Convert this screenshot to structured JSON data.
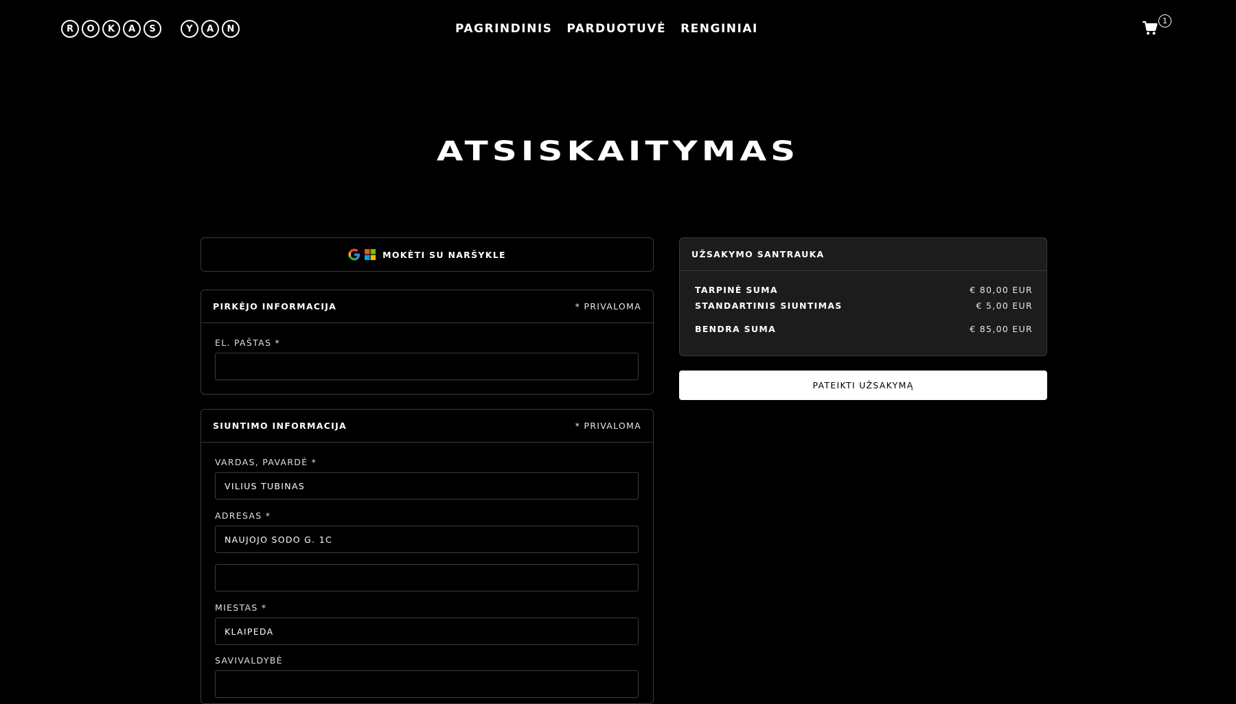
{
  "logo": {
    "first": [
      "R",
      "O",
      "K",
      "A",
      "S"
    ],
    "second": [
      "Y",
      "A",
      "N"
    ]
  },
  "nav": [
    "PAGRINDINIS",
    "PARDUOTUVĖ",
    "RENGINIAI"
  ],
  "cart": {
    "icon": "cart-icon",
    "count": "1"
  },
  "page_title": "ATSISKAITYMAS",
  "browser_pay": {
    "label": "MOKĖTI SU NARŠYKLE",
    "icons": [
      "google-icon",
      "microsoft-icon"
    ]
  },
  "buyer": {
    "title": "PIRKĖJO INFORMACIJA",
    "required_note": "* PRIVALOMA",
    "email_label": "EL. PAŠTAS *",
    "email_value": ""
  },
  "shipping": {
    "title": "SIUNTIMO INFORMACIJA",
    "required_note": "* PRIVALOMA",
    "name_label": "VARDAS, PAVARDĖ *",
    "name_value": "VILIUS TUBINAS",
    "address_label": "ADRESAS *",
    "address_value": "NAUJOJO SODO G. 1C",
    "address2_value": "",
    "city_label": "MIESTAS *",
    "city_value": "KLAIPEDA",
    "municipality_label": "SAVIVALDYBĖ",
    "municipality_value": ""
  },
  "summary": {
    "title": "UŽSAKYMO SANTRAUKA",
    "subtotal_label": "TARPINĖ SUMA",
    "subtotal_value": "€ 80,00 EUR",
    "shipping_label": "STANDARTINIS SIUNTIMAS",
    "shipping_value": "€ 5,00 EUR",
    "total_label": "BENDRA SUMA",
    "total_value": "€ 85,00 EUR"
  },
  "submit_label": "PATEIKTI UŽSAKYMĄ",
  "colors": {
    "background": "#000000",
    "summary_bg": "#1c1c1c",
    "border": "#3a3a3a",
    "submit_bg": "#ffffff"
  }
}
